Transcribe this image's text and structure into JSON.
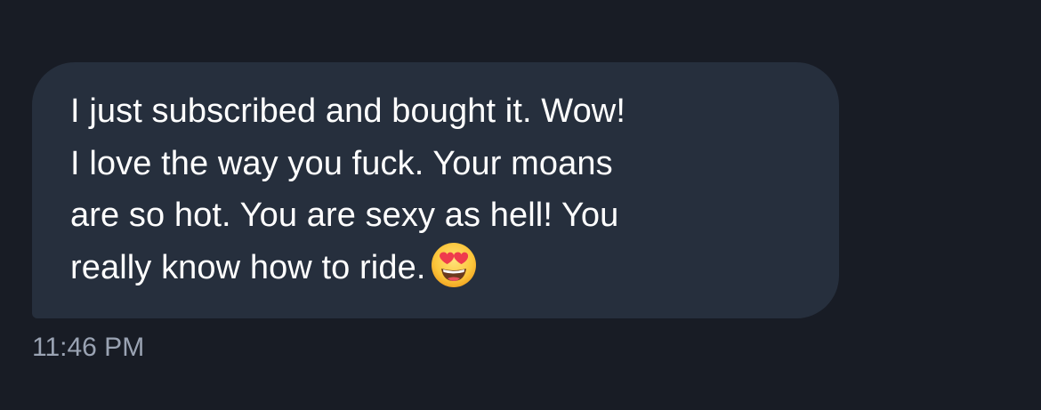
{
  "conversation": {
    "message": {
      "text_lines": [
        "I just subscribed and bought it.  Wow!",
        "I love the way you fuck.  Your moans",
        "are so hot.  You are sexy as hell!  You",
        "really know how to ride."
      ],
      "emoji": "smiling-face-with-heart-eyes",
      "timestamp": "11:46 PM"
    }
  },
  "colors": {
    "background": "#181c25",
    "bubble": "#262f3d",
    "message_text": "#ffffff",
    "timestamp_text": "#9aa3b3"
  }
}
